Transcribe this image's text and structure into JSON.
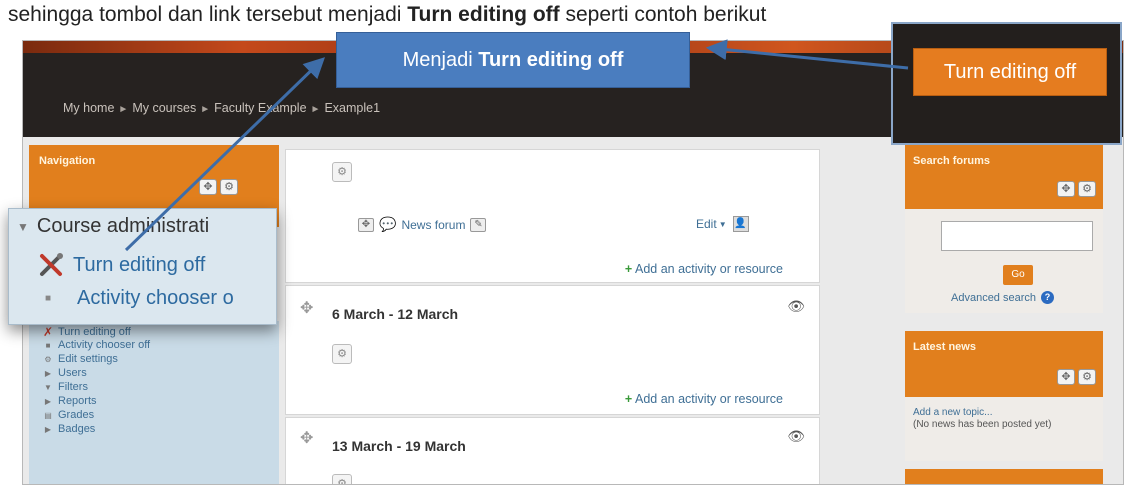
{
  "caption": {
    "before": "sehingga tombol dan link tersebut menjadi ",
    "bold": "Turn editing off",
    "after": " seperti contoh berikut"
  },
  "breadcrumb": [
    "My home",
    "My courses",
    "Faculty Example",
    "Example1"
  ],
  "breadcrumb_sep": "►",
  "navigation": {
    "title": "Navigation",
    "admin_items": [
      {
        "label": "Turn editing off",
        "icon": "wrench-screwdriver-icon"
      },
      {
        "label": "Activity chooser off",
        "icon": "bullet-icon"
      },
      {
        "label": "Edit settings",
        "icon": "gear-icon"
      },
      {
        "label": "Users",
        "icon": "triangle-right-icon"
      },
      {
        "label": "Filters",
        "icon": "filter-icon"
      },
      {
        "label": "Reports",
        "icon": "triangle-right-icon"
      },
      {
        "label": "Grades",
        "icon": "grades-icon"
      },
      {
        "label": "Badges",
        "icon": "triangle-right-icon"
      }
    ]
  },
  "sections": [
    {
      "title": "",
      "forum_label": "News forum",
      "edit_label": "Edit",
      "add_label": "Add an activity or resource"
    },
    {
      "title": "6 March - 12 March",
      "add_label": "Add an activity or resource"
    },
    {
      "title": "13 March - 19 March"
    }
  ],
  "search_forums": {
    "title": "Search forums",
    "go_label": "Go",
    "advanced_label": "Advanced search"
  },
  "latest_news": {
    "title": "Latest news",
    "add_topic": "Add a new topic...",
    "no_news": "(No news has been posted yet)"
  },
  "callouts": {
    "top_prefix": "Menjadi ",
    "top_bold": "Turn editing off",
    "right_button": "Turn editing off",
    "left_course_admin": "Course administrati",
    "left_turn_off": "Turn editing off",
    "left_activity": "Activity chooser o"
  },
  "colors": {
    "accent_orange": "#e17f1d",
    "callout_blue": "#4a7dbf",
    "link_blue": "#3f6f95",
    "navbar_dark": "#262220"
  }
}
